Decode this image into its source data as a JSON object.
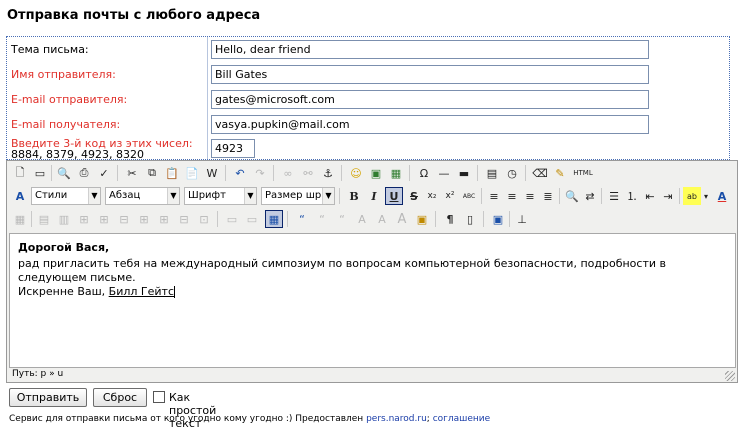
{
  "page": {
    "title": "Отправка почты с любого адреса"
  },
  "form": {
    "subject": {
      "label": "Тема письма:",
      "value": "Hello, dear friend"
    },
    "sender_name": {
      "label": "Имя отправителя:",
      "value": "Bill Gates"
    },
    "sender_email": {
      "label": "E-mail отправителя:",
      "value": "gates@microsoft.com"
    },
    "recipient_email": {
      "label": "E-mail получателя:",
      "value": "vasya.pupkin@mail.com"
    },
    "captcha": {
      "label": "Введите 3-й код из этих чисел:",
      "numbers": "8884, 8379, 4923, 8320",
      "value": "4923"
    },
    "label_color": "#e0302a"
  },
  "editor": {
    "selects": {
      "styles": "Стили",
      "paragraph": "Абзац",
      "font": "Шрифт",
      "font_size": "Размер шрифт"
    },
    "toolbar_glyphs": {
      "bold": "B",
      "italic": "I",
      "underline": "U",
      "strike": "S",
      "sub": "x₂",
      "sup": "x²",
      "abc": "ABC",
      "html": "HTML",
      "omega": "Ω",
      "pilcrow": "¶"
    },
    "content": {
      "greeting": "Дорогой Вася,",
      "body": "рад пригласить тебя на международный симпозиум по вопросам компьютерной безопасности, подробности в следующем письме.",
      "closing": "Искренне Ваш, ",
      "signature": "Билл Гейтс"
    },
    "status_path": "Путь: p » u"
  },
  "actions": {
    "send": "Отправить",
    "reset": "Сброс",
    "plain_text": "Как простой текст"
  },
  "footer": {
    "text": "Сервис для отправки письма от кого угодно кому угодно :) Предоставлен",
    "site_link": "pers.narod.ru",
    "separator": ";",
    "agreement_link": "соглашение"
  }
}
